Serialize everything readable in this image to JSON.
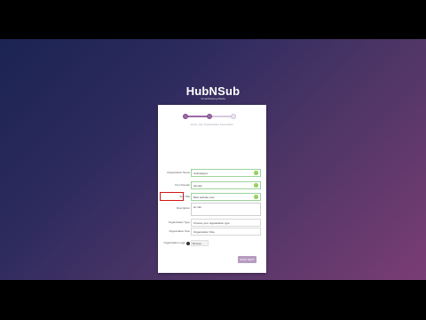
{
  "brand": {
    "name": "HubNSub",
    "tagline": "SmartSharing Media"
  },
  "wizard": {
    "hint": "Enter your Organization Information",
    "fields": [
      {
        "label": "Organization Name",
        "value": "nicknaagrys",
        "valid": true
      },
      {
        "label": "Your Domain",
        "value": "domain",
        "valid": true
      },
      {
        "label": "Sub Title",
        "value": "Best website ever",
        "valid": true
      },
      {
        "label": "Description",
        "value": "an info"
      },
      {
        "label": "Organization Type",
        "value": "Choose your organization type"
      },
      {
        "label": "Organization Size",
        "value": "Organization Size"
      },
      {
        "label": "Organization Logo",
        "value": "Browse"
      }
    ],
    "save_label": "SAVE NEXT"
  },
  "colors": {
    "accent": "#9d6aa8",
    "highlight": "#d01818",
    "valid": "#8ccf4d"
  }
}
